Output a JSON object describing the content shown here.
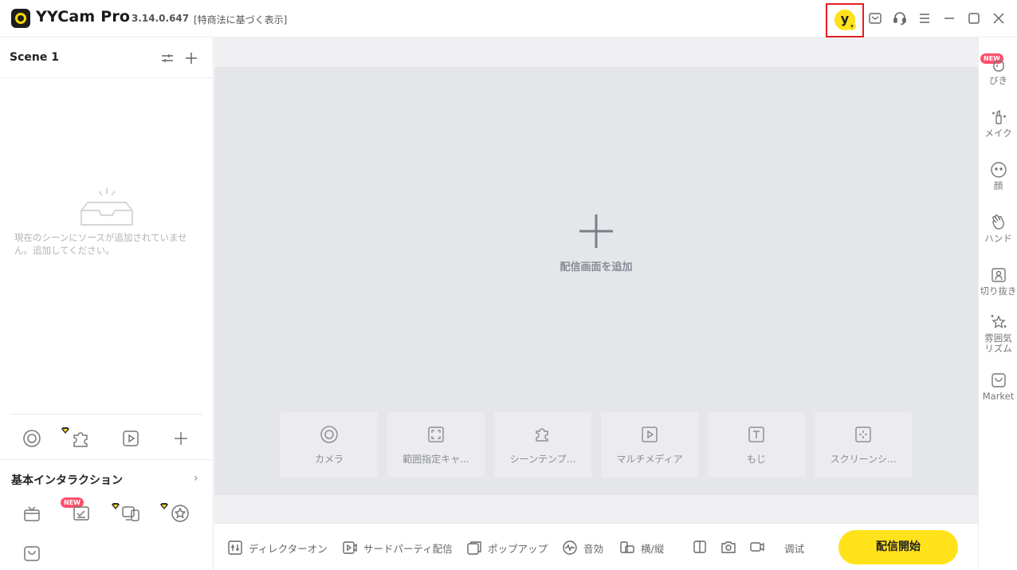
{
  "titlebar": {
    "app_name": "YYCam Pro",
    "version": "3.14.0.647",
    "legal_link": "[特商法に基づく表示]",
    "avatar_letter": "y",
    "icons": [
      "mail-icon",
      "support-icon",
      "menu-icon",
      "minimize-icon",
      "maximize-icon",
      "close-icon"
    ]
  },
  "scene_panel": {
    "title": "Scene 1",
    "empty_message": "現在のシーンにソースが追加されていません。追加してください。"
  },
  "basic_interaction": {
    "title": "基本インタラクション",
    "new_badge": "NEW"
  },
  "canvas": {
    "add_label": "配信画面を追加",
    "tiles": [
      {
        "label": "カメラ",
        "icon": "camera-icon"
      },
      {
        "label": "範囲指定キャ...",
        "icon": "region-capture-icon"
      },
      {
        "label": "シーンテンプ...",
        "icon": "puzzle-icon"
      },
      {
        "label": "マルチメディア",
        "icon": "media-icon"
      },
      {
        "label": "もじ",
        "icon": "text-icon"
      },
      {
        "label": "スクリーンシ...",
        "icon": "screen-icon"
      }
    ]
  },
  "rightbar": {
    "new_badge": "NEW",
    "items": [
      {
        "label": "びき"
      },
      {
        "label": "メイク"
      },
      {
        "label": "顔"
      },
      {
        "label": "ハンド"
      },
      {
        "label": "切り抜き"
      },
      {
        "label": "雰囲気\nリズム"
      },
      {
        "label": "Market"
      }
    ]
  },
  "bottombar": {
    "director_on": "ディレクターオン",
    "third_party": "サードパーティ配信",
    "popup": "ポップアップ",
    "sound_effect": "音効",
    "orientation": "横/縦",
    "debug": "调试",
    "start_stream": "配信開始"
  },
  "colors": {
    "accent_yellow": "#ffe21a",
    "highlight_red": "#e21f26",
    "new_badge": "#ff4f6d"
  }
}
